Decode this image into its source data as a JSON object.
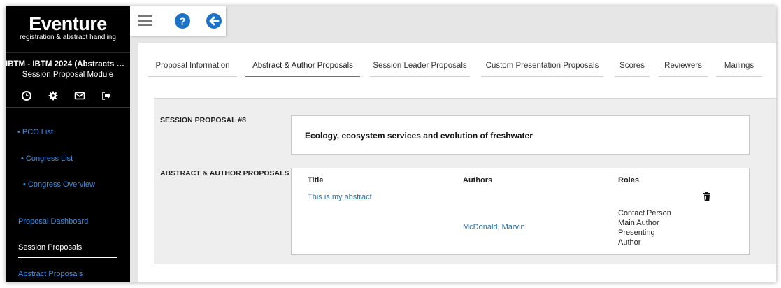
{
  "brand": {
    "logo_text": "Eventure",
    "logo_subtitle": "registration & abstract handling"
  },
  "sidebar": {
    "congress_title": "IBTM - IBTM 2024 (Abstracts & Par...",
    "module_title": "Session Proposal Module",
    "icons": [
      "clock-icon",
      "gear-icon",
      "envelope-icon",
      "logout-icon"
    ],
    "links": [
      {
        "label": "• PCO List"
      },
      {
        "label": "• Congress List"
      },
      {
        "label": "• Congress Overview"
      },
      {
        "label": "Proposal Dashboard"
      },
      {
        "label": "Session Proposals"
      },
      {
        "label": "Abstract Proposals"
      }
    ]
  },
  "toolbar": {
    "icons": [
      "menu-icon",
      "help-icon",
      "back-arrow-icon"
    ]
  },
  "tabs": [
    {
      "label": "Proposal Information"
    },
    {
      "label": "Abstract & Author Proposals"
    },
    {
      "label": "Session Leader Proposals"
    },
    {
      "label": "Custom Presentation Proposals"
    },
    {
      "label": "Scores"
    },
    {
      "label": "Reviewers"
    },
    {
      "label": "Mailings"
    }
  ],
  "active_tab": "Abstract & Author Proposals",
  "session": {
    "label": "SESSION PROPOSAL #8",
    "title": "Ecology, ecosystem services and evolution of freshwater"
  },
  "abstracts": {
    "label": "ABSTRACT & AUTHOR PROPOSALS",
    "columns": {
      "title": "Title",
      "authors": "Authors",
      "roles": "Roles"
    },
    "rows": [
      {
        "title": "This is my abstract",
        "author": "McDonald, Marvin",
        "roles": [
          "Contact Person",
          "Main Author",
          "Presenting",
          "Author"
        ]
      }
    ]
  },
  "colors": {
    "sidebar_bg": "#000000",
    "link": "#1f6fb5",
    "sidebar_link": "#3a8fe6",
    "help_blue": "#1a73c9",
    "active_tab_underline": "#3b82c4"
  }
}
